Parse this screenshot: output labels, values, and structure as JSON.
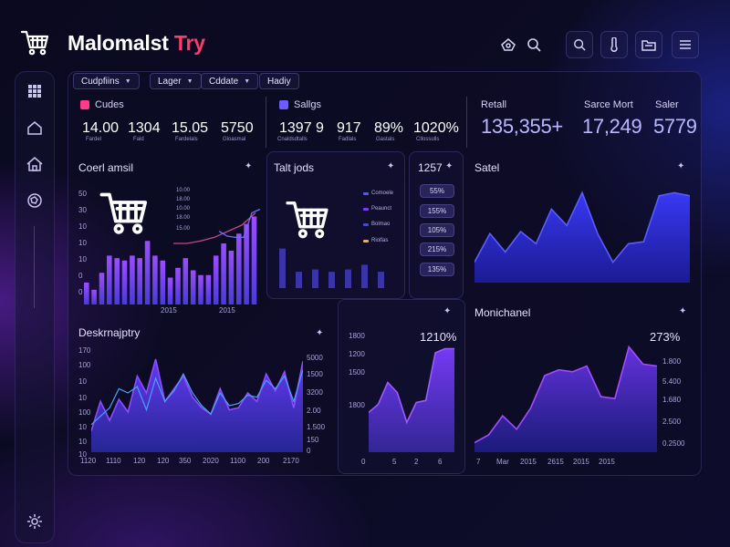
{
  "app": {
    "brand_main": "Malomalst",
    "brand_accent": "Try"
  },
  "colors": {
    "accent": "#ff3b6b",
    "purple": "#7b3cff",
    "blue": "#3b46ff",
    "panel_border": "#6e66d8"
  },
  "header": {
    "icons": [
      "home-outline-icon",
      "search-icon",
      "search-icon",
      "thermometer-icon",
      "folder-icon",
      "menu-icon"
    ]
  },
  "sidebar": {
    "icons": [
      "grid-icon",
      "home-icon",
      "house-icon",
      "globe-icon",
      "settings-icon"
    ]
  },
  "filters": [
    {
      "label": "Cudpfiins",
      "has_caret": true
    },
    {
      "label": "Lager",
      "has_caret": true
    },
    {
      "label": "Cddate",
      "has_caret": true
    },
    {
      "label": "Hadiy",
      "has_caret": false
    }
  ],
  "kpis": {
    "group1": {
      "label": "Cudes",
      "items": [
        {
          "value": "14.00",
          "caption": "Fardel"
        },
        {
          "value": "1304",
          "caption": "Fald"
        },
        {
          "value": "15.05",
          "caption": "Fardelals"
        },
        {
          "value": "5750",
          "caption": "Gloasmal"
        }
      ]
    },
    "group2": {
      "label": "Sallgs",
      "items": [
        {
          "value": "1397 9",
          "caption": "Cnaldsdtalls"
        },
        {
          "value": "917",
          "caption": "Fadlals"
        },
        {
          "value": "89%",
          "caption": "Gastals"
        },
        {
          "value": "1020%",
          "caption": "Cllossulls"
        }
      ]
    },
    "group3": [
      {
        "label": "Retall",
        "value": "135,355+"
      },
      {
        "label": "Sarce Mort",
        "value": "17,249"
      },
      {
        "label": "Saler",
        "value": "5779"
      }
    ]
  },
  "cards": {
    "card1": {
      "title": "Coerl amsil",
      "y_ticks": [
        "50",
        "30",
        "10",
        "10",
        "10",
        "0",
        "0"
      ],
      "x_ticks": [
        "2015",
        "2015"
      ],
      "legend_values": [
        "10.00",
        "18.00",
        "10.00",
        "18.00",
        "15.00"
      ]
    },
    "card2": {
      "title": "Talt jods",
      "header_value": "1257",
      "legend": [
        {
          "label": "Comoele",
          "color": "#4b5bff"
        },
        {
          "label": "Peaunct",
          "color": "#7b3cff"
        },
        {
          "label": "Bolmao",
          "color": "#3b46ff"
        },
        {
          "label": "Riolfas",
          "color": "#ffb020"
        }
      ],
      "pills": [
        "55%",
        "155%",
        "105%",
        "215%",
        "135%"
      ]
    },
    "card3": {
      "title": "Satel"
    },
    "card4": {
      "title": "Deskrnajptry",
      "y_left": [
        "170",
        "100",
        "10",
        "10",
        "100",
        "10",
        "10",
        "10"
      ],
      "y_right": [
        "5000",
        "1500",
        "3200",
        "2.00",
        "1.500",
        "150",
        "0"
      ],
      "x_ticks": [
        "1120",
        "1110",
        "120",
        "120",
        "350",
        "2020",
        "1100",
        "200",
        "2170"
      ]
    },
    "card5": {
      "header_value": "1210%",
      "y_ticks": [
        "1800",
        "1200",
        "1500",
        "1800"
      ],
      "x_ticks": [
        "0",
        "5",
        "2",
        "6"
      ]
    },
    "card6": {
      "title": "Monichanel",
      "header_value": "273%",
      "y_ticks": [
        "1.800",
        "5.400",
        "1.680",
        "2.500",
        "0.2500"
      ],
      "x_ticks": [
        "7",
        "Mar",
        "2015",
        "2615",
        "2015",
        "2015"
      ]
    }
  },
  "chart_data": [
    {
      "type": "bar",
      "name": "card1",
      "values": [
        18,
        12,
        26,
        40,
        38,
        36,
        40,
        38,
        52,
        40,
        36,
        22,
        30,
        38,
        28,
        24,
        24,
        40,
        50,
        44,
        58,
        66,
        72
      ]
    },
    {
      "type": "line",
      "name": "card1-lines",
      "series": [
        {
          "values": [
            50,
            50,
            52,
            55,
            60,
            65,
            75
          ]
        },
        {
          "values": [
            60,
            56,
            55,
            55,
            75,
            78
          ]
        }
      ]
    },
    {
      "type": "bar",
      "name": "card2",
      "values": [
        34,
        14,
        16,
        14,
        16,
        20,
        14
      ]
    },
    {
      "type": "area",
      "name": "card3",
      "values": [
        20,
        48,
        30,
        50,
        38,
        72,
        56,
        88,
        48,
        20,
        38,
        40,
        85,
        88,
        85
      ]
    },
    {
      "type": "area",
      "name": "card4",
      "series": [
        {
          "name": "purple",
          "values": [
            20,
            48,
            30,
            50,
            38,
            72,
            56,
            88,
            48,
            60,
            72,
            52,
            42,
            36,
            60,
            40,
            42,
            56,
            48,
            74,
            58,
            76,
            42,
            86
          ]
        },
        {
          "name": "blue",
          "values": [
            26,
            34,
            42,
            60,
            56,
            62,
            40,
            70,
            48,
            58,
            74,
            56,
            44,
            36,
            56,
            44,
            46,
            54,
            52,
            68,
            60,
            72,
            48,
            78
          ]
        }
      ]
    },
    {
      "type": "area",
      "name": "card5",
      "values": [
        40,
        48,
        70,
        60,
        30,
        50,
        52,
        100,
        104,
        104
      ]
    },
    {
      "type": "area",
      "name": "card6",
      "values": [
        10,
        18,
        38,
        24,
        46,
        80,
        86,
        84,
        90,
        58,
        56,
        110,
        92,
        90
      ]
    }
  ]
}
